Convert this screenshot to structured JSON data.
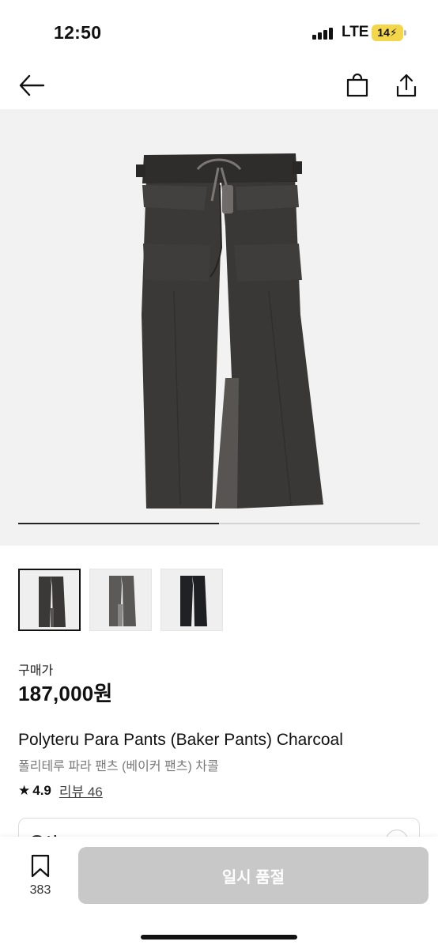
{
  "status_bar": {
    "time": "12:50",
    "network": "LTE",
    "battery": "14"
  },
  "gallery": {
    "progress": 0.5,
    "thumbnails": [
      "charcoal",
      "grey",
      "black"
    ],
    "active_thumbnail": 0
  },
  "product": {
    "price_label": "구매가",
    "price": "187,000원",
    "title_en": "Polyteru Para Pants (Baker Pants) Charcoal",
    "title_ko": "폴리테루 파라 팬츠 (베이커 팬츠) 차콜",
    "rating_star": "★",
    "rating": "4.9",
    "review_link": "리뷰 46"
  },
  "option": {
    "label": "옵션"
  },
  "bottom_bar": {
    "wish_count": "383",
    "cta_label": "일시 품절"
  },
  "colors": {
    "cta_disabled": "#c8c8c8",
    "battery": "#f3d64a",
    "pants_charcoal": "#3b3937"
  },
  "icons": [
    "back-arrow-icon",
    "shopping-bag-icon",
    "share-icon",
    "star-icon",
    "bookmark-icon"
  ]
}
